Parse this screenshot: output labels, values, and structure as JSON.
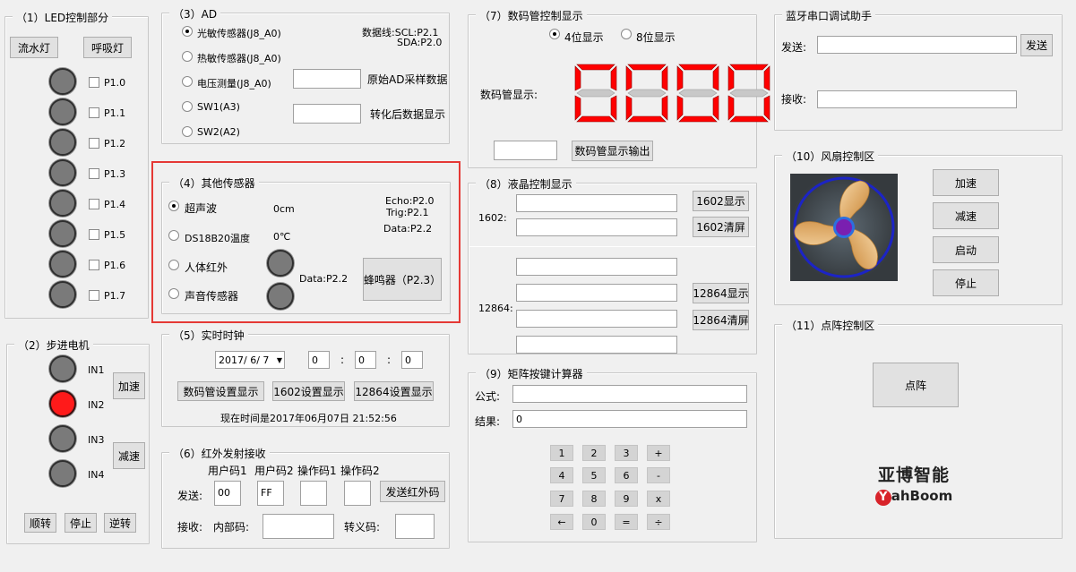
{
  "led_panel": {
    "title": "（1）LED控制部分",
    "btn_flow": "流水灯",
    "btn_breath": "呼吸灯",
    "pins": [
      "P1.0",
      "P1.1",
      "P1.2",
      "P1.3",
      "P1.4",
      "P1.5",
      "P1.6",
      "P1.7"
    ]
  },
  "stepper": {
    "title": "（2）步进电机",
    "coils": [
      "IN1",
      "IN2",
      "IN3",
      "IN4"
    ],
    "active_coil_color": "#ff1a1a",
    "btn_speed_up": "加速",
    "btn_slow_down": "减速",
    "btn_forward": "顺转",
    "btn_stop": "停止",
    "btn_reverse": "逆转"
  },
  "ad": {
    "title": "（3）AD",
    "options": [
      "光敏传感器(J8_A0)",
      "热敏传感器(J8_A0)",
      "电压测量(J8_A0)",
      "SW1(A3)",
      "SW2(A2)"
    ],
    "bus_line1": "数据线:SCL:P2.1",
    "bus_line2": "SDA:P2.0",
    "raw_label": "原始AD采样数据",
    "converted_label": "转化后数据显示"
  },
  "other_sensors": {
    "title": "（4）其他传感器",
    "ultrasonic": "超声波",
    "ultrasonic_value": "0cm",
    "echo": "Echo:P2.0",
    "trig": "Trig:P2.1",
    "ds18b20": "DS18B20温度",
    "temp_value": "0℃",
    "ds_data": "Data:P2.2",
    "pir": "人体红外",
    "pir_data": "Data:P2.2",
    "sound": "声音传感器",
    "buzzer_btn": "蜂鸣器（P2.3）",
    "highlight_color": "#e53935"
  },
  "rtc": {
    "title": "（5）实时时钟",
    "date": "2017/ 6/ 7",
    "hour": "0",
    "minute": "0",
    "second": "0",
    "sep": ":",
    "btn_seg": "数码管设置显示",
    "btn_1602": "1602设置显示",
    "btn_12864": "12864设置显示",
    "now_text": "现在时间是2017年06月07日 21:52:56"
  },
  "ir": {
    "title": "（6）红外发射接收",
    "headers": [
      "用户码1",
      "用户码2",
      "操作码1",
      "操作码2"
    ],
    "send_label": "发送:",
    "code1": "00",
    "code2": "FF",
    "code3": "",
    "code4": "",
    "btn_send": "发送红外码",
    "recv_label": "接收:",
    "inner_label": "内部码:",
    "escape_label": "转义码:"
  },
  "seg": {
    "title": "（7）数码管控制显示",
    "opt4": "4位显示",
    "opt8": "8位显示",
    "display_label": "数码管显示:",
    "digits": "0000",
    "btn_output": "数码管显示输出",
    "digit_color": "#ff0000"
  },
  "lcd": {
    "title": "（8）液晶控制显示",
    "label_1602": "1602:",
    "btn_1602_show": "1602显示",
    "btn_1602_clear": "1602清屏",
    "label_12864": "12864:",
    "btn_12864_show": "12864显示",
    "btn_12864_clear": "12864清屏"
  },
  "calc": {
    "title": "（9）矩阵按键计算器",
    "formula_label": "公式:",
    "result_label": "结果:",
    "result_value": "0",
    "keys": [
      [
        "1",
        "2",
        "3",
        "+"
      ],
      [
        "4",
        "5",
        "6",
        "-"
      ],
      [
        "7",
        "8",
        "9",
        "x"
      ],
      [
        "←",
        "0",
        "=",
        "÷"
      ]
    ]
  },
  "bt": {
    "title": "蓝牙串口调试助手",
    "send_label": "发送:",
    "btn_send": "发送",
    "recv_label": "接收:"
  },
  "fan": {
    "title": "（10）风扇控制区",
    "btn_up": "加速",
    "btn_down": "减速",
    "btn_start": "启动",
    "btn_stop": "停止"
  },
  "matrix": {
    "title": "（11）点阵控制区",
    "btn_matrix": "点阵"
  },
  "logo": {
    "cn": "亚博智能",
    "en_initial": "Y",
    "en_rest": "ahBoom"
  }
}
